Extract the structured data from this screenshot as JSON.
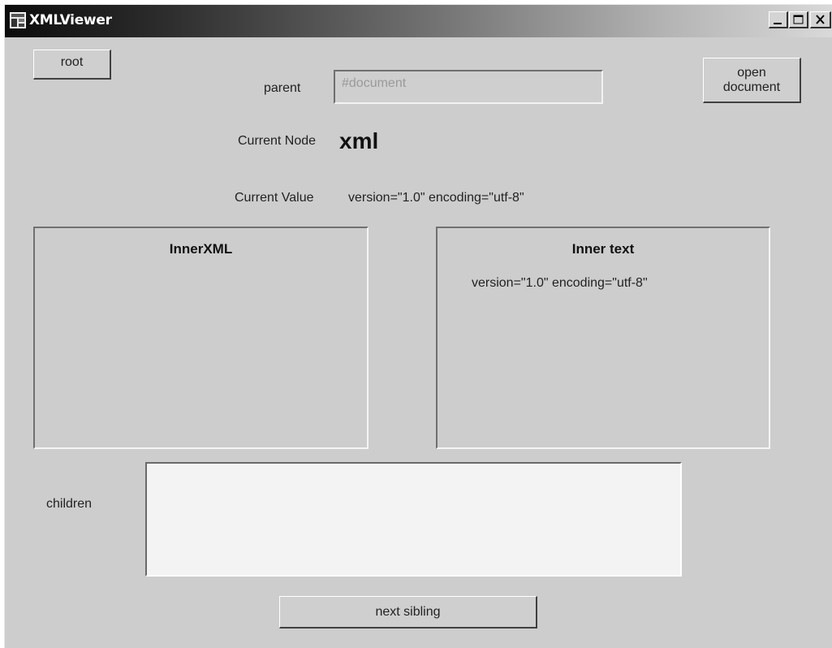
{
  "window": {
    "title": "XMLViewer"
  },
  "toolbar": {
    "root_label": "root",
    "open_document_label": "open document",
    "next_sibling_label": "next sibling"
  },
  "parent": {
    "label": "parent",
    "value": "#document"
  },
  "current_node": {
    "label": "Current Node",
    "value": "xml"
  },
  "current_value": {
    "label": "Current Value",
    "value": "version=\"1.0\" encoding=\"utf-8\""
  },
  "inner_xml": {
    "title": "InnerXML",
    "content": ""
  },
  "inner_text": {
    "title": "Inner text",
    "content": "version=\"1.0\" encoding=\"utf-8\""
  },
  "children": {
    "label": "children",
    "items": []
  }
}
